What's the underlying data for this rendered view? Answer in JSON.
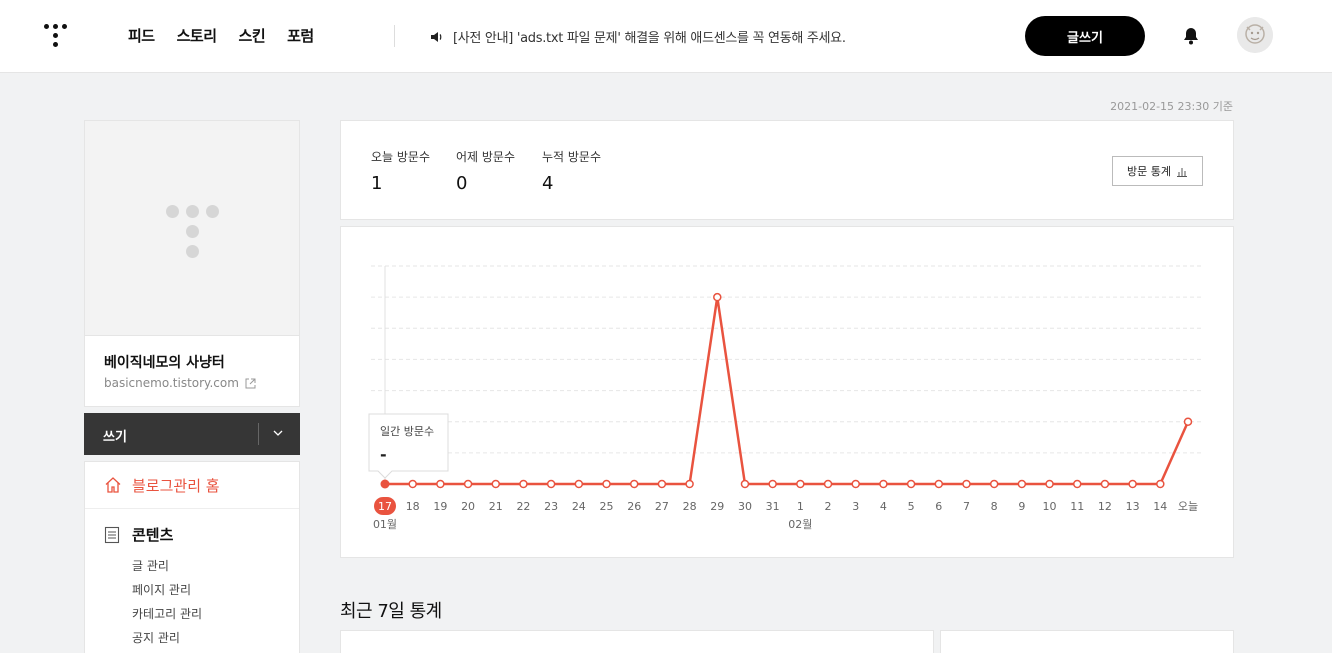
{
  "header": {
    "nav": [
      "피드",
      "스토리",
      "스킨",
      "포럼"
    ],
    "notice": "[사전 안내] 'ads.txt 파일 문제' 해결을 위해 애드센스를 꼭 연동해 주세요.",
    "write_button": "글쓰기",
    "icons": {
      "logo": "tistory-logo",
      "speaker": "speaker-icon",
      "bell": "bell-icon",
      "avatar": "avatar"
    }
  },
  "base_time": "2021-02-15 23:30 기준",
  "blog": {
    "name": "베이직네모의 사냥터",
    "url": "basicnemo.tistory.com",
    "write_label": "쓰기"
  },
  "menu": {
    "home": "블로그관리 홈",
    "section": "콘텐츠",
    "items": [
      "글 관리",
      "페이지 관리",
      "카테고리 관리",
      "공지 관리"
    ]
  },
  "stats": {
    "today_label": "오늘 방문수",
    "today_value": "1",
    "yesterday_label": "어제 방문수",
    "yesterday_value": "0",
    "total_label": "누적 방문수",
    "total_value": "4",
    "button": "방문 통계"
  },
  "chart_data": {
    "type": "line",
    "x": [
      "17",
      "18",
      "19",
      "20",
      "21",
      "22",
      "23",
      "24",
      "25",
      "26",
      "27",
      "28",
      "29",
      "30",
      "31",
      "1",
      "2",
      "3",
      "4",
      "5",
      "6",
      "7",
      "8",
      "9",
      "10",
      "11",
      "12",
      "13",
      "14",
      "오늘"
    ],
    "month_labels": [
      {
        "index": 0,
        "label": "01월"
      },
      {
        "index": 15,
        "label": "02월"
      }
    ],
    "series": [
      {
        "values": [
          0,
          0,
          0,
          0,
          0,
          0,
          0,
          0,
          0,
          0,
          0,
          0,
          3,
          0,
          0,
          0,
          0,
          0,
          0,
          0,
          0,
          0,
          0,
          0,
          0,
          0,
          0,
          0,
          0,
          1
        ]
      }
    ],
    "ylim": [
      0,
      3.5
    ],
    "selected_index": 0,
    "tooltip_label": "일간 방문수",
    "tooltip_value": "-",
    "color": "#e9533f",
    "grid": true
  },
  "recent_title": "최근 7일 통계"
}
